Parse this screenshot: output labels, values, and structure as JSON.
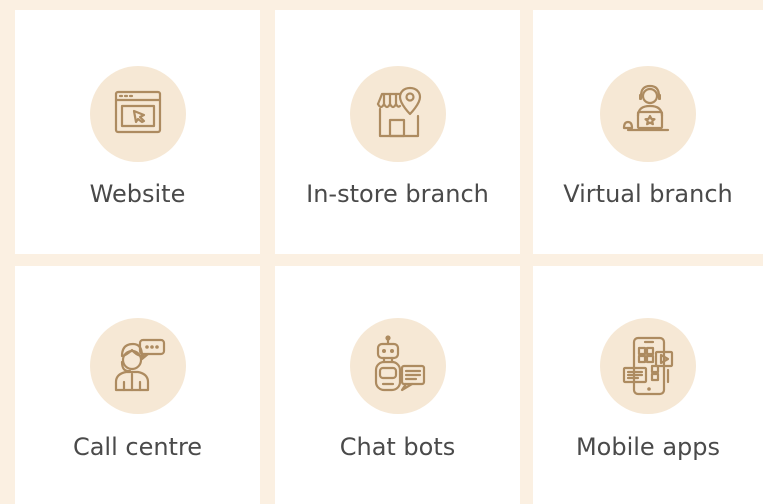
{
  "colors": {
    "background": "#fbf0e2",
    "card": "#ffffff",
    "icon_circle": "#f6e8d5",
    "icon_stroke": "#ad8b60",
    "label_text": "#4a4a4a"
  },
  "channels": [
    {
      "label": "Website",
      "icon": "browser-cursor-icon"
    },
    {
      "label": "In-store branch",
      "icon": "storefront-pin-icon"
    },
    {
      "label": "Virtual branch",
      "icon": "agent-laptop-icon"
    },
    {
      "label": "Call centre",
      "icon": "call-agent-icon"
    },
    {
      "label": "Chat bots",
      "icon": "chatbot-icon"
    },
    {
      "label": "Mobile apps",
      "icon": "mobile-apps-icon"
    }
  ]
}
